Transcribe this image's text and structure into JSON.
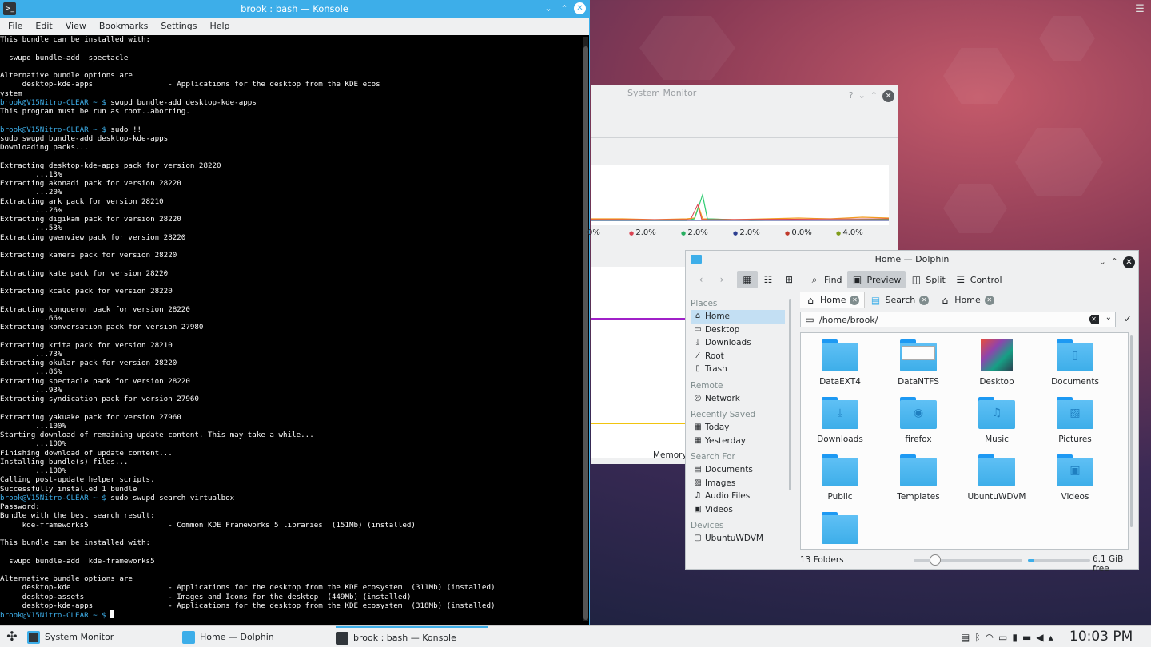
{
  "konsole": {
    "title": "brook : bash — Konsole",
    "menu": [
      "File",
      "Edit",
      "View",
      "Bookmarks",
      "Settings",
      "Help"
    ],
    "lines": [
      {
        "t": "This bundle can be installed with:"
      },
      {
        "t": ""
      },
      {
        "t": "  swupd bundle-add  spectacle"
      },
      {
        "t": ""
      },
      {
        "t": "Alternative bundle options are"
      },
      {
        "t": "     desktop-kde-apps                 - Applications for the desktop from the KDE ecos"
      },
      {
        "t": "ystem"
      },
      {
        "p": "brook@V15Nitro-CLEAR ~ $ ",
        "t": "swupd bundle-add desktop-kde-apps"
      },
      {
        "t": "This program must be run as root..aborting."
      },
      {
        "t": ""
      },
      {
        "p": "brook@V15Nitro-CLEAR ~ $ ",
        "t": "sudo !!"
      },
      {
        "t": "sudo swupd bundle-add desktop-kde-apps"
      },
      {
        "t": "Downloading packs..."
      },
      {
        "t": ""
      },
      {
        "t": "Extracting desktop-kde-apps pack for version 28220"
      },
      {
        "t": "        ...13%"
      },
      {
        "t": "Extracting akonadi pack for version 28220"
      },
      {
        "t": "        ...20%"
      },
      {
        "t": "Extracting ark pack for version 28210"
      },
      {
        "t": "        ...26%"
      },
      {
        "t": "Extracting digikam pack for version 28220"
      },
      {
        "t": "        ...53%"
      },
      {
        "t": "Extracting gwenview pack for version 28220"
      },
      {
        "t": ""
      },
      {
        "t": "Extracting kamera pack for version 28220"
      },
      {
        "t": ""
      },
      {
        "t": "Extracting kate pack for version 28220"
      },
      {
        "t": ""
      },
      {
        "t": "Extracting kcalc pack for version 28220"
      },
      {
        "t": ""
      },
      {
        "t": "Extracting konqueror pack for version 28220"
      },
      {
        "t": "        ...66%"
      },
      {
        "t": "Extracting konversation pack for version 27980"
      },
      {
        "t": ""
      },
      {
        "t": "Extracting krita pack for version 28210"
      },
      {
        "t": "        ...73%"
      },
      {
        "t": "Extracting okular pack for version 28220"
      },
      {
        "t": "        ...86%"
      },
      {
        "t": "Extracting spectacle pack for version 28220"
      },
      {
        "t": "        ...93%"
      },
      {
        "t": "Extracting syndication pack for version 27960"
      },
      {
        "t": ""
      },
      {
        "t": "Extracting yakuake pack for version 27960"
      },
      {
        "t": "        ...100%"
      },
      {
        "t": "Starting download of remaining update content. This may take a while..."
      },
      {
        "t": "        ...100%"
      },
      {
        "t": "Finishing download of update content..."
      },
      {
        "t": "Installing bundle(s) files..."
      },
      {
        "t": "        ...100%"
      },
      {
        "t": "Calling post-update helper scripts."
      },
      {
        "t": "Successfully installed 1 bundle"
      },
      {
        "p": "brook@V15Nitro-CLEAR ~ $ ",
        "t": "sudo swupd search virtualbox"
      },
      {
        "t": "Password:"
      },
      {
        "t": "Bundle with the best search result:"
      },
      {
        "t": "     kde-frameworks5                  - Common KDE Frameworks 5 libraries  (151Mb) (installed)"
      },
      {
        "t": ""
      },
      {
        "t": "This bundle can be installed with:"
      },
      {
        "t": ""
      },
      {
        "t": "  swupd bundle-add  kde-frameworks5"
      },
      {
        "t": ""
      },
      {
        "t": "Alternative bundle options are"
      },
      {
        "t": "     desktop-kde                      - Applications for the desktop from the KDE ecosystem  (311Mb) (installed)"
      },
      {
        "t": "     desktop-assets                   - Images and Icons for the desktop  (449Mb) (installed)"
      },
      {
        "t": "     desktop-kde-apps                 - Applications for the desktop from the KDE ecosystem  (318Mb) (installed)"
      },
      {
        "p": "brook@V15Nitro-CLEAR ~ $ ",
        "t": "",
        "cursor": true
      }
    ]
  },
  "sysmon": {
    "title": "System Monitor",
    "legend": [
      {
        "text": "0%",
        "color": "#232629"
      },
      {
        "text": "2.0%",
        "color": "#da4453"
      },
      {
        "text": "2.0%",
        "color": "#27ae60"
      },
      {
        "text": "2.0%",
        "color": "#2c3e90"
      },
      {
        "text": "0.0%",
        "color": "#c0392b"
      },
      {
        "text": "4.0%",
        "color": "#7f9c1a"
      }
    ],
    "memory_label": "Memory:"
  },
  "dolphin": {
    "title": "Home — Dolphin",
    "toolbar": {
      "find": "Find",
      "preview": "Preview",
      "split": "Split",
      "control": "Control"
    },
    "tabs": [
      {
        "label": "Home",
        "active": true
      },
      {
        "label": "Search"
      },
      {
        "label": "Home"
      }
    ],
    "path": "/home/brook/",
    "places": [
      {
        "head": "Places",
        "items": [
          {
            "label": "Home",
            "icon": "home-icon",
            "sel": true
          },
          {
            "label": "Desktop",
            "icon": "desktop-icon"
          },
          {
            "label": "Downloads",
            "icon": "download-icon"
          },
          {
            "label": "Root",
            "icon": "root-icon"
          },
          {
            "label": "Trash",
            "icon": "trash-icon"
          }
        ]
      },
      {
        "head": "Remote",
        "items": [
          {
            "label": "Network",
            "icon": "network-icon"
          }
        ]
      },
      {
        "head": "Recently Saved",
        "items": [
          {
            "label": "Today",
            "icon": "calendar-icon"
          },
          {
            "label": "Yesterday",
            "icon": "calendar-icon"
          }
        ]
      },
      {
        "head": "Search For",
        "items": [
          {
            "label": "Documents",
            "icon": "document-icon"
          },
          {
            "label": "Images",
            "icon": "image-icon"
          },
          {
            "label": "Audio Files",
            "icon": "audio-icon"
          },
          {
            "label": "Videos",
            "icon": "video-icon"
          }
        ]
      },
      {
        "head": "Devices",
        "items": [
          {
            "label": "UbuntuWDVM",
            "icon": "drive-icon"
          }
        ]
      }
    ],
    "files": [
      {
        "name": "DataEXT4",
        "kind": "folder"
      },
      {
        "name": "DataNTFS",
        "kind": "ntfs"
      },
      {
        "name": "Desktop",
        "kind": "desktop"
      },
      {
        "name": "Documents",
        "kind": "documents"
      },
      {
        "name": "Downloads",
        "kind": "downloads"
      },
      {
        "name": "firefox",
        "kind": "firefox"
      },
      {
        "name": "Music",
        "kind": "music"
      },
      {
        "name": "Pictures",
        "kind": "pictures"
      },
      {
        "name": "Public",
        "kind": "folder"
      },
      {
        "name": "Templates",
        "kind": "folder"
      },
      {
        "name": "UbuntuWDVM",
        "kind": "folder"
      },
      {
        "name": "Videos",
        "kind": "videos"
      },
      {
        "name": "",
        "kind": "folder"
      }
    ],
    "status": "13 Folders",
    "free_space": "6.1 GiB free",
    "zoom_level": 0.2,
    "disk_used_fraction": 0.1
  },
  "taskbar": {
    "tasks": [
      {
        "label": "System Monitor",
        "icon": "system-monitor-icon"
      },
      {
        "label": "Home — Dolphin",
        "icon": "dolphin-icon"
      },
      {
        "label": "brook : bash — Konsole",
        "icon": "konsole-icon",
        "active": true
      }
    ],
    "clock": "10:03 PM"
  },
  "colors": {
    "accent": "#3daee9",
    "panel": "#eff0f1"
  }
}
